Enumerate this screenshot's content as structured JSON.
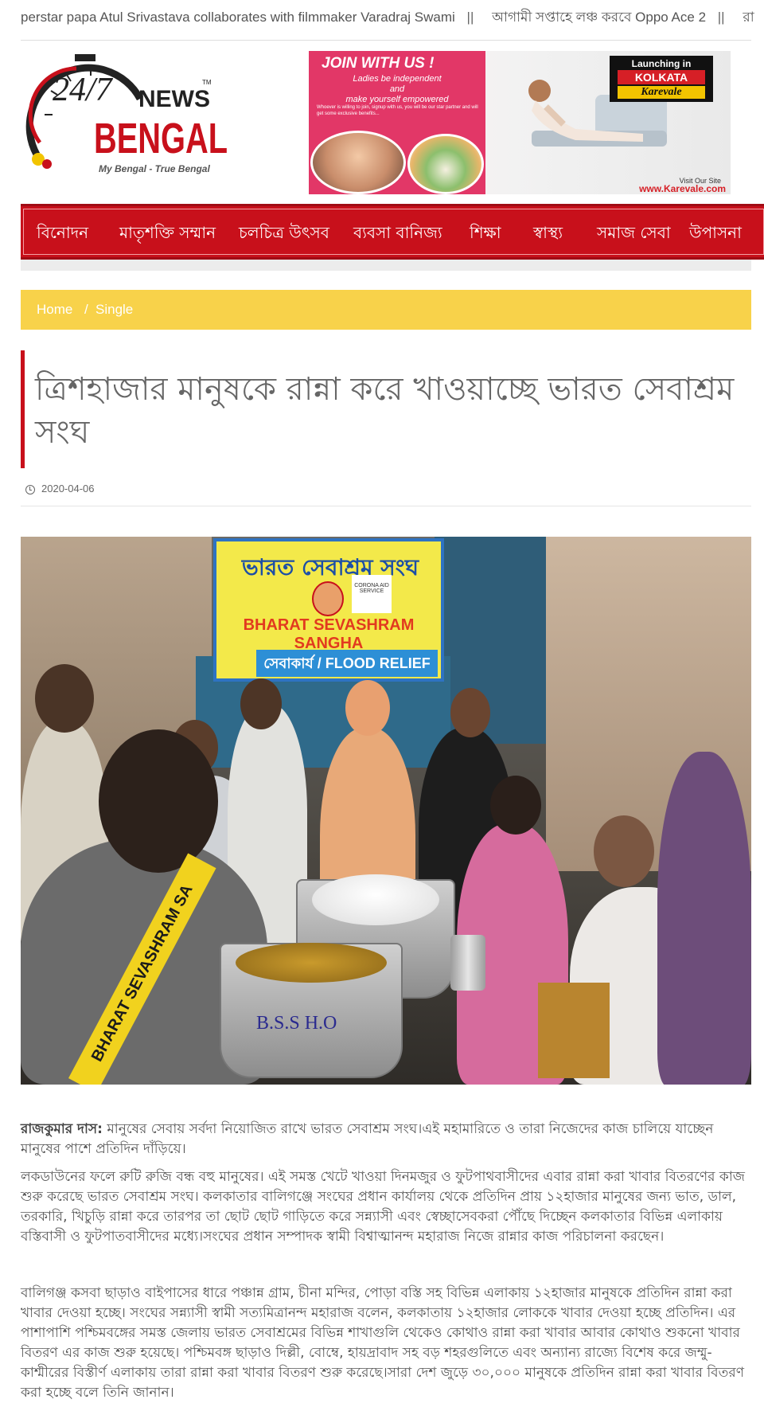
{
  "ticker": {
    "items": [
      "perstar papa Atul Srivastava collaborates with filmmaker Varadraj Swami",
      "আগামী সপ্তাহে লঞ্চ করবে Oppo Ace 2",
      "রা"
    ],
    "separator": "||"
  },
  "logo": {
    "number": "24/7",
    "word1": "NEWS",
    "word2": "BENGAL",
    "tm": "TM",
    "tagline": "My Bengal - True Bengal"
  },
  "ad": {
    "headline": "JOIN WITH US !",
    "line1": "Ladies be independent",
    "line2": "and",
    "line3": "make yourself empowered",
    "note": "Whoever is willing to join, signup with us, you will be our star partner and will get some exclusive benefits...",
    "badge_top": "Launching in",
    "badge_city": "KOLKATA",
    "badge_brand": "Karevale",
    "visit": "Visit Our Site",
    "url": "www.Karevale.com"
  },
  "nav": {
    "items": [
      "বিনোদন",
      "মাতৃশক্তি সম্মান",
      "চলচিত্র উৎসব",
      "ব্যবসা বানিজ্য",
      "শিক্ষা",
      "স্বাস্থ্য",
      "সমাজ সেবা",
      "উপাসনা"
    ]
  },
  "breadcrumb": {
    "home": "Home",
    "separator": "/",
    "current": "Single"
  },
  "article": {
    "title": "ত্রিশহাজার মানুষকে রান্না করে খাওয়াচ্ছে ভারত সেবাশ্রম সংঘ",
    "date": "2020-04-06",
    "photo": {
      "banner_bengali": "ভারত সেবাশ্রম সংঘ",
      "banner_english": "BHARAT SEVASHRAM SANGHA",
      "banner_relief": "সেবাকার্য / FLOOD RELIEF",
      "corona_label": "CORONA AID SERVICE",
      "sash_text": "BHARAT SEVASHRAM SA",
      "pot_text": "B.S.S H.O"
    },
    "author": "রাজকুমার দাস:",
    "p1": " মানুষের সেবায় সর্বদা নিয়োজিত রাখে ভারত সেবাশ্রম সংঘ।এই মহামারিতে ও তারা নিজেদের কাজ চালিয়ে যাচ্ছেন মানুষের পাশে প্রতিদিন দাঁড়িয়ে।",
    "p2": "লকডাউনের ফলে রুটি রুজি বন্ধ বহু মানুষের। এই সমস্ত খেটে খাওয়া দিনমজুর ও ফুটপাথবাসীদের এবার রান্না করা খাবার বিতরণের কাজ শুরু করেছে ভারত সেবাশ্রম সংঘ। কলকাতার বালিগঞ্জে সংঘের প্রধান কার্যালয় থেকে প্রতিদিন প্রায় ১২হাজার মানুষের জন্য ভাত, ডাল, তরকারি, খিচুড়ি রান্না করে তারপর তা ছোট ছোট গাড়িতে করে সন্ন্যাসী এবং স্বেচ্ছাসেবকরা পৌঁছে দিচ্ছেন কলকাতার বিভিন্ন এলাকায় বস্তিবাসী ও ফুটপাতবাসীদের মধ্যে।সংঘের প্রধান সম্পাদক স্বামী বিশ্বাত্মানন্দ মহারাজ নিজে রান্নার কাজ পরিচালনা করছেন।",
    "p3": "বালিগঞ্জ কসবা ছাড়াও বাইপাসের ধারে পঞ্চান্ন গ্রাম, চীনা মন্দির, পোড়া বস্তি সহ বিভিন্ন এলাকায় ১২হাজার মানুষকে প্রতিদিন রান্না করা খাবার দেওয়া হচ্ছে। সংঘের সন্ন্যাসী স্বামী সত্যমিত্রানন্দ মহারাজ বলেন, কলকাতায় ১২হাজার লোককে খাবার দেওয়া হচ্ছে প্রতিদিন। এর পাশাপাশি পশ্চিমবঙ্গের সমস্ত জেলায় ভারত সেবাশ্রমের বিভিন্ন শাখাগুলি থেকেও কোথাও রান্না করা খাবার আবার কোথাও শুকনো খাবার বিতরণ এর কাজ শুরু হয়েছে। পশ্চিমবঙ্গ ছাড়াও দিল্লী, বোম্বে, হায়দ্রাবাদ সহ বড় শহরগুলিতে এবং অন্যান্য রাজ্যে বিশেষ করে জম্মু-কাশ্মীরের বিস্তীর্ণ এলাকায় তারা রান্না করা খাবার বিতরণ শুরু করেছে।সারা দেশ জুড়ে ৩০,০০০ মানুষকে প্রতিদিন রান্না করা খাবার বিতরণ করা হচ্ছে বলে তিনি জানান।"
  },
  "colors": {
    "brand_red": "#c8101b",
    "breadcrumb_yellow": "#f8d24a",
    "ad_pink": "#e23767"
  }
}
